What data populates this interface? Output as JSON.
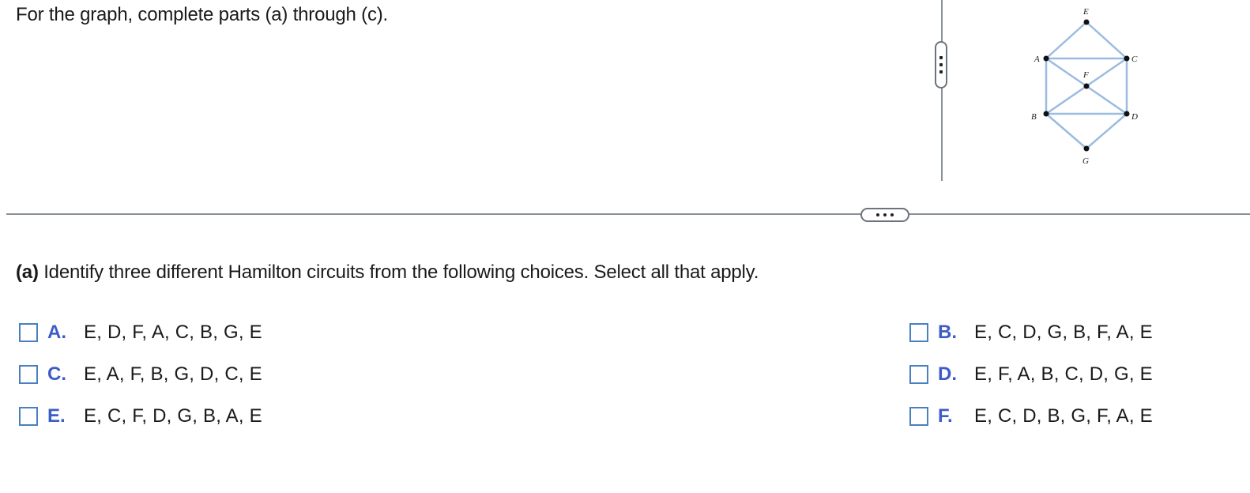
{
  "prompt": "For the graph, complete parts (a) through (c).",
  "graph": {
    "vertex_labels": {
      "E": "E",
      "A": "A",
      "C": "C",
      "F": "F",
      "B": "B",
      "D": "D",
      "G": "G"
    },
    "edge_color": "#9bbbe0"
  },
  "question": {
    "part_label": "(a)",
    "text": " Identify three different Hamilton circuits from the following choices. Select all that apply."
  },
  "choices": [
    {
      "letter": "A.",
      "text": "E, D, F, A, C, B, G, E"
    },
    {
      "letter": "B.",
      "text": "E, C, D, G, B, F, A, E"
    },
    {
      "letter": "C.",
      "text": "E, A, F, B, G, D, C, E"
    },
    {
      "letter": "D.",
      "text": "E, F, A, B, C, D, G, E"
    },
    {
      "letter": "E.",
      "text": "E, C, F, D, G, B, A, E"
    },
    {
      "letter": "F.",
      "text": "E, C, D, B, G, F, A, E"
    }
  ],
  "colors": {
    "choice_letter": "#3d5cc7",
    "checkbox_border": "#4a7fc0",
    "divider": "#8a8f98"
  }
}
